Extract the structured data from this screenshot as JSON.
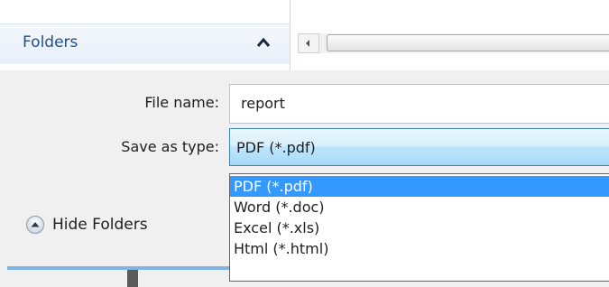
{
  "sidebar": {
    "folders_label": "Folders"
  },
  "form": {
    "file_name_label": "File name:",
    "file_name_value": "report",
    "save_type_label": "Save as type:",
    "save_type_value": "PDF (*.pdf)",
    "save_type_options": [
      "PDF (*.pdf)",
      "Word (*.doc)",
      "Excel (*.xls)",
      "Html (*.html)"
    ]
  },
  "footer": {
    "hide_folders_label": "Hide Folders"
  },
  "colors": {
    "link_blue": "#1f4e8c",
    "selection": "#3399ff",
    "select_border": "#3c7fb1"
  },
  "icons": [
    "chevron-up-icon",
    "scroll-left-arrow-icon",
    "collapse-up-icon"
  ]
}
